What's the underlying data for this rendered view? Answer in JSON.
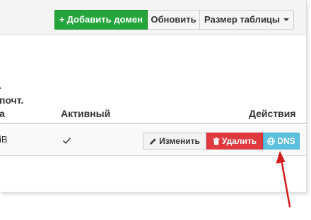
{
  "toolbar": {
    "add_domain_label": "Добавить домен",
    "refresh_label": "Обновить",
    "table_size_label": "Размер таблицы"
  },
  "table": {
    "header_fragments": [
      ".",
      "почт.",
      "а"
    ],
    "active_header": "Активный",
    "actions_header": "Действия",
    "row": {
      "partial_text": "iB",
      "active_icon": "checkmark-icon",
      "edit_label": "Изменить",
      "delete_label": "Удалить",
      "dns_label": "DNS"
    }
  },
  "icons": {
    "add": "plus-icon",
    "table_size": "caret-down-icon",
    "edit": "pencil-icon",
    "delete": "trash-icon",
    "dns": "globe-icon"
  },
  "colors": {
    "add_button": "#23a53b",
    "delete_button": "#e03a3e",
    "dns_button": "#5bc0de",
    "annotation_arrow": "#d11f1f"
  }
}
